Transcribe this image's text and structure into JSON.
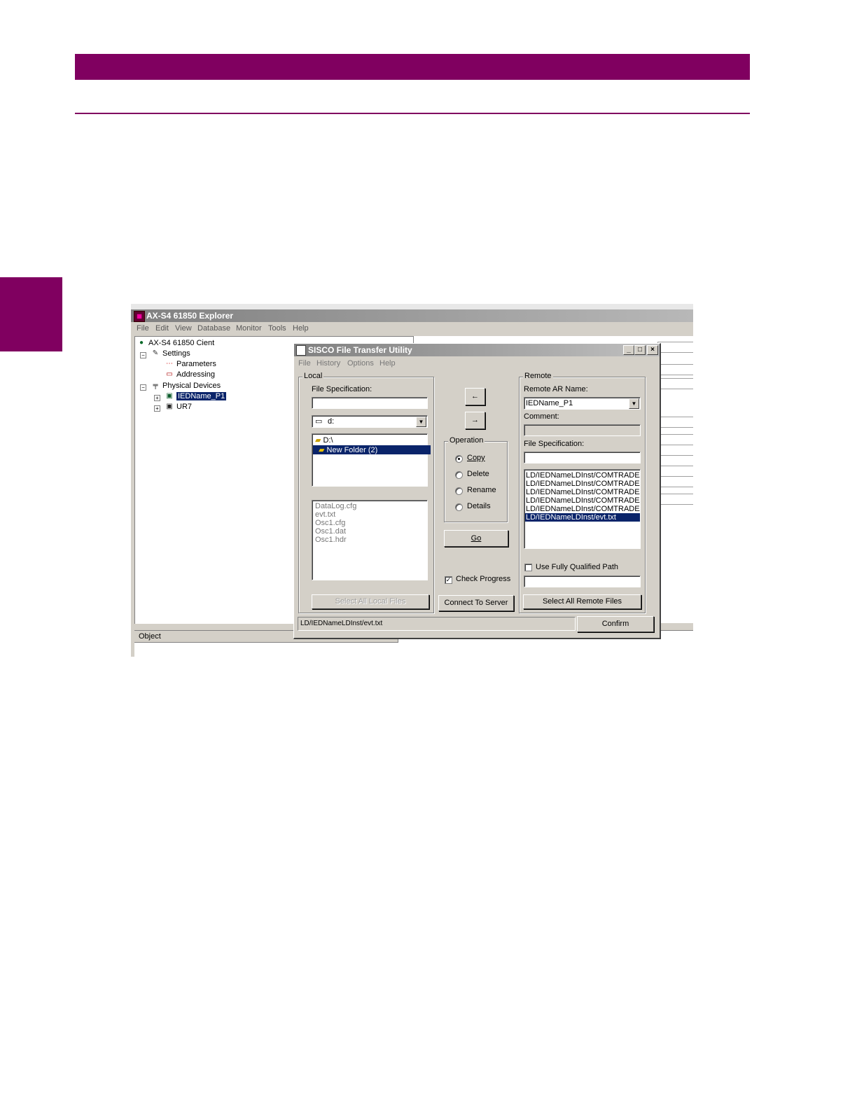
{
  "explorer": {
    "title": "AX-S4 61850 Explorer",
    "menu": [
      "File",
      "Edit",
      "View",
      "Database",
      "Monitor",
      "Tools",
      "Help"
    ],
    "tree": {
      "root": "AX-S4 61850 Cient",
      "settings": "Settings",
      "parameters": "Parameters",
      "addressing": "Addressing",
      "physical_devices": "Physical Devices",
      "device1": "IEDName_P1",
      "device2": "UR7"
    },
    "bottom_header": "Object"
  },
  "dialog": {
    "title": "SISCO File Transfer Utility",
    "menu": [
      "File",
      "History",
      "Options",
      "Help"
    ],
    "local": {
      "group_label": "Local",
      "file_spec_label": "File Specification:",
      "file_spec_value": "",
      "drive": "d:",
      "folders": [
        "D:\\",
        "New Folder (2)"
      ],
      "selected_folder_index": 1,
      "files": [
        "DataLog.cfg",
        "evt.txt",
        "Osc1.cfg",
        "Osc1.dat",
        "Osc1.hdr"
      ],
      "select_all_button": "Select All Local Files"
    },
    "middle": {
      "arrow_left": "←",
      "arrow_right": "→",
      "operation_label": "Operation",
      "operations": [
        "Copy",
        "Delete",
        "Rename",
        "Details"
      ],
      "selected_operation": "Copy",
      "go_button": "Go",
      "check_progress_label": "Check Progress",
      "check_progress_checked": true,
      "connect_button": "Connect To Server"
    },
    "remote": {
      "group_label": "Remote",
      "ar_name_label": "Remote AR Name:",
      "ar_name_value": "IEDName_P1",
      "comment_label": "Comment:",
      "comment_value": "",
      "file_spec_label": "File Specification:",
      "file_spec_value": "",
      "files": [
        "LD/IEDNameLDInst/COMTRADE/D",
        "LD/IEDNameLDInst/COMTRADE/D",
        "LD/IEDNameLDInst/COMTRADE/C",
        "LD/IEDNameLDInst/COMTRADE/C",
        "LD/IEDNameLDInst/COMTRADE/C",
        "LD/IEDNameLDInst/evt.txt"
      ],
      "selected_file_index": 5,
      "fully_qualified_label": "Use Fully Qualified Path",
      "fully_qualified_checked": false,
      "path_value": "",
      "select_all_button": "Select All Remote Files"
    },
    "status_text": "LD/IEDNameLDInst/evt.txt",
    "confirm_button": "Confirm"
  },
  "colors": {
    "brand": "#800060",
    "selection": "#0a246a",
    "face": "#d4d0c8"
  }
}
